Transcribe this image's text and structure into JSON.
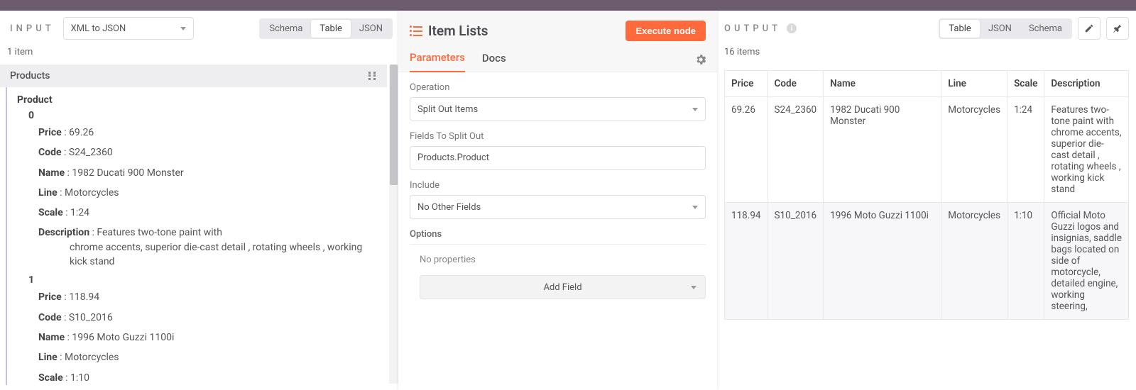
{
  "input": {
    "title": "INPUT",
    "source_select": "XML to JSON",
    "view_tabs": [
      "Schema",
      "Table",
      "JSON"
    ],
    "active_view": "Table",
    "item_count_label": "1 item",
    "root_key": "Products",
    "child_key": "Product",
    "items": [
      {
        "index": "0",
        "Price": "69.26",
        "Code": "S24_2360",
        "Name": "1982 Ducati 900 Monster",
        "Line": "Motorcycles",
        "Scale": "1:24",
        "Description_first": "Features two-tone paint with",
        "Description_rest": "chrome accents, superior die-cast detail , rotating wheels , working kick stand"
      },
      {
        "index": "1",
        "Price": "118.94",
        "Code": "S10_2016",
        "Name": "1996 Moto Guzzi 1100i",
        "Line": "Motorcycles",
        "Scale": "1:10"
      }
    ]
  },
  "center": {
    "title": "Item Lists",
    "execute_label": "Execute node",
    "tabs": [
      "Parameters",
      "Docs"
    ],
    "fields": {
      "operation": {
        "label": "Operation",
        "value": "Split Out Items"
      },
      "fields_to_split": {
        "label": "Fields To Split Out",
        "value": "Products.Product"
      },
      "include": {
        "label": "Include",
        "value": "No Other Fields"
      }
    },
    "options_label": "Options",
    "no_properties": "No properties",
    "add_field_label": "Add Field"
  },
  "output": {
    "title": "OUTPUT",
    "view_tabs": [
      "Table",
      "JSON",
      "Schema"
    ],
    "active_view": "Table",
    "item_count_label": "16 items",
    "columns": [
      "Price",
      "Code",
      "Name",
      "Line",
      "Scale",
      "Description"
    ],
    "rows": [
      {
        "Price": "69.26",
        "Code": "S24_2360",
        "Name": "1982 Ducati 900 Monster",
        "Line": "Motorcycles",
        "Scale": "1:24",
        "Description": "Features two-tone paint with chrome accents, superior die-cast detail , rotating wheels , working kick stand"
      },
      {
        "Price": "118.94",
        "Code": "S10_2016",
        "Name": "1996 Moto Guzzi 1100i",
        "Line": "Motorcycles",
        "Scale": "1:10",
        "Description": "Official Moto Guzzi logos and insignias, saddle bags located on side of motorcycle, detailed engine, working steering,"
      }
    ]
  }
}
